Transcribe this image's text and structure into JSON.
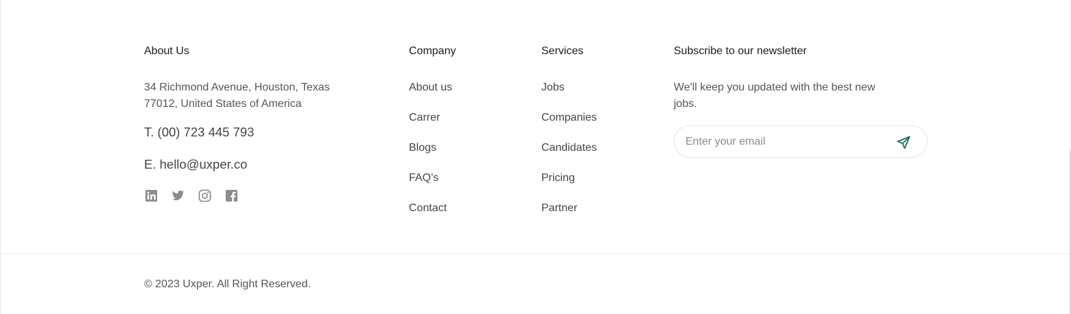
{
  "about": {
    "heading": "About Us",
    "address": "34 Richmond Avenue, Houston, Texas 77012, United States of America",
    "phone": "T. (00) 723 445 793",
    "email": "E. hello@uxper.co",
    "social": [
      "linkedin-icon",
      "twitter-icon",
      "instagram-icon",
      "facebook-icon"
    ]
  },
  "company": {
    "heading": "Company",
    "links": [
      "About us",
      "Carrer",
      "Blogs",
      "FAQ’s",
      "Contact"
    ]
  },
  "services": {
    "heading": "Services",
    "links": [
      "Jobs",
      "Companies",
      "Candidates",
      "Pricing",
      "Partner"
    ]
  },
  "newsletter": {
    "heading": "Subscribe to our newsletter",
    "description": "We'll keep you updated with the best new jobs.",
    "placeholder": "Enter your email",
    "send_icon": "send-icon"
  },
  "footer": {
    "copyright": "© 2023 Uxper. All Right Reserved."
  },
  "colors": {
    "accent": "#1f6f5c",
    "icon_gray": "#8c8c8c",
    "text": "#555555"
  }
}
